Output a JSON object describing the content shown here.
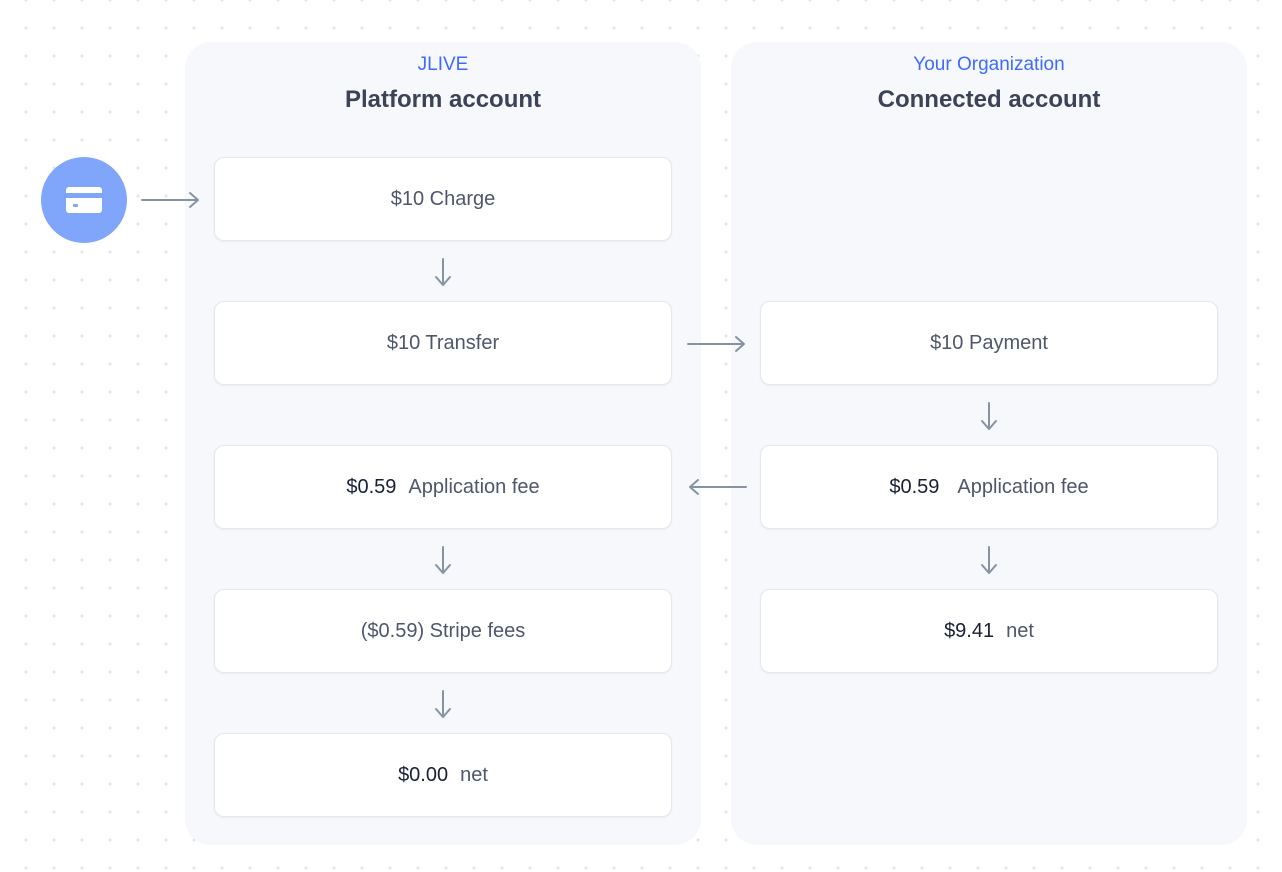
{
  "platform": {
    "subtitle": "JLIVE",
    "title": "Platform account",
    "charge": {
      "text": "$10 Charge"
    },
    "transfer": {
      "text": "$10 Transfer"
    },
    "app_fee": {
      "amount": "$0.59",
      "label": "Application fee"
    },
    "stripe_fees": {
      "text": "($0.59) Stripe fees"
    },
    "net": {
      "amount": "$0.00",
      "label": "net"
    }
  },
  "connected": {
    "subtitle": "Your Organization",
    "title": "Connected account",
    "payment": {
      "text": "$10 Payment"
    },
    "app_fee": {
      "amount": "$0.59",
      "label": "Application fee"
    },
    "net": {
      "amount": "$9.41",
      "label": "net"
    }
  },
  "icons": {
    "payment_source": "credit-card-icon"
  },
  "colors": {
    "accent": "#3e6bff",
    "card_circle": "#7fa6fb",
    "panel_bg": "#f6f8fb",
    "arrow": "#8792a2"
  }
}
